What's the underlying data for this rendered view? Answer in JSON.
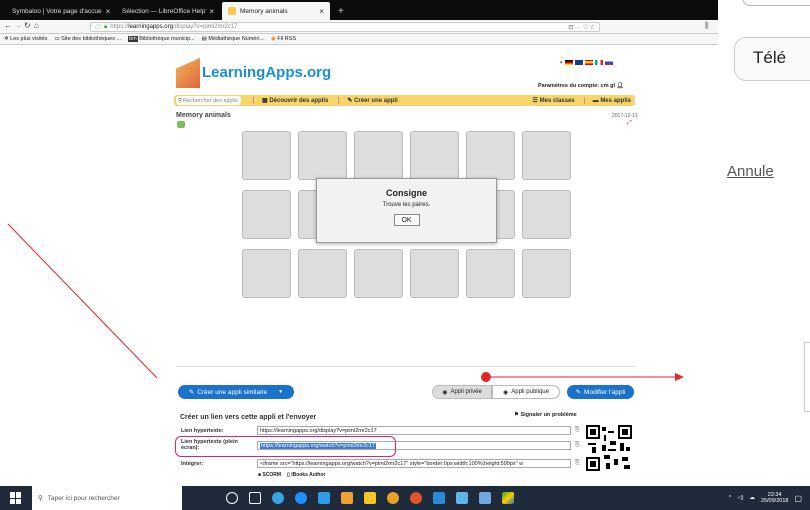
{
  "browser": {
    "tabs": [
      {
        "label": "Symbaloo | Votre page d'accue",
        "active": false
      },
      {
        "label": "Sélection — LibreOffice Help",
        "active": false
      },
      {
        "label": "Memory animals",
        "active": true
      }
    ],
    "new_tab": "+",
    "url_scheme": "https://",
    "url_domain": "learningapps.org",
    "url_path": "/display?v=pimi2mr2c17",
    "url_menu": "⊡ ··· ♡ ☆",
    "bookmarks": [
      "Les plus visités",
      "Site des bibliothèques ...",
      "Bibliothèque municip...",
      "Médiathèque Numéri...",
      "Fil RSS"
    ]
  },
  "site": {
    "logo": "LearningApps.org",
    "account_label": "Paramètres du compte: cm gl",
    "search_placeholder": "Rechercher des applis",
    "nav_discover": "Découvrir des applis",
    "nav_create": "Créer une appli",
    "nav_classes": "Mes classes",
    "nav_apps": "Mes applis",
    "app_title": "Memory animals",
    "app_date": "2017-12-13",
    "expand_icon_glyph": "⤢"
  },
  "dialog": {
    "title": "Consigne",
    "text": "Trouve les paires.",
    "ok": "OK"
  },
  "actions": {
    "create_similar": "Créer une appli similaire",
    "private": "Appli privée",
    "public": "Appli publique",
    "edit": "Modifier l'appli"
  },
  "share": {
    "heading": "Créer un lien vers cette appli et l'envoyer",
    "report": "Signaler un problème",
    "hyperlink_label": "Lien hypertexte:",
    "hyperlink_value": "https://learningapps.org/display?v=pimi2mr2c17",
    "fullscreen_label_1": "Lien hypertexte (plein",
    "fullscreen_label_2": "écran):",
    "fullscreen_value": "https://learningapps.org/watch?v=pimi2mr2c17",
    "embed_label": "Intégrer:",
    "embed_value": "<iframe src=\"https://learningapps.org/watch?v=pimi2mr2c17\" style=\"border:0px;width:100%;height:500px\" w",
    "scorm": "SCORM",
    "ibooks": "iBooks Author"
  },
  "right_pane": {
    "download_partial": "Télé",
    "cancel_partial": "Annule"
  },
  "taskbar": {
    "search_placeholder": "Taper ici pour rechercher",
    "time": "22:34",
    "date": "25/09/2018"
  },
  "colors": {
    "accent": "#1a73c8",
    "highlight_ring": "#e0216f",
    "annotation_red": "#e0262b",
    "nav_yellow": "#f7d56b"
  }
}
